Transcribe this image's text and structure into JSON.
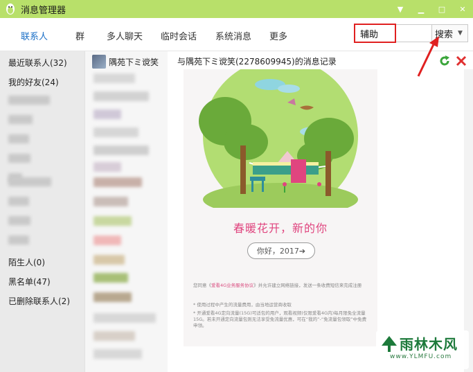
{
  "window": {
    "title": "消息管理器"
  },
  "nav": {
    "tabs": [
      {
        "label": "联系人",
        "active": true
      },
      {
        "label": "群"
      },
      {
        "label": "多人聊天"
      },
      {
        "label": "临时会话"
      },
      {
        "label": "系统消息"
      },
      {
        "label": "更多"
      }
    ]
  },
  "search": {
    "value": "辅助",
    "button_label": "搜索"
  },
  "sidebar": {
    "items": [
      {
        "label": "最近联系人(32)"
      },
      {
        "label": "我的好友(24)"
      },
      {
        "label": "陌生人(0)"
      },
      {
        "label": "黑名单(47)"
      },
      {
        "label": "已删除联系人(2)"
      }
    ]
  },
  "contacts": {
    "selected_name": "隅苑下ミ谠笑"
  },
  "history": {
    "title": "与隅苑下ミ谠笑(2278609945)的消息记录"
  },
  "message": {
    "slogan": "春暖花开，新的你",
    "button_label": "你好，2017➔",
    "fine_1a": "您同意《",
    "fine_link": "爱看4G业务服务协议",
    "fine_1b": "》并允许建立网络链接，发送一条收费短信来完成注册",
    "fine_2": "* 使用过程中产生的流量费用，由当地运营商收取",
    "fine_3": "* 开通爱看4G定向流量(15G)可适包的用户，观看视频(仅限爱看4G内)每月限免全流量15G。若未开通定向流量包则无法享受免流量优惠，可在“我的”-“免流量包领取”中免费申领。"
  },
  "watermark": {
    "text": "雨林木风",
    "url": "www.YLMFU.com"
  },
  "colors": {
    "titlebar": "#b8e06a",
    "accent": "#1a6fc7",
    "highlight": "#e02020",
    "slogan": "#e0457f"
  }
}
